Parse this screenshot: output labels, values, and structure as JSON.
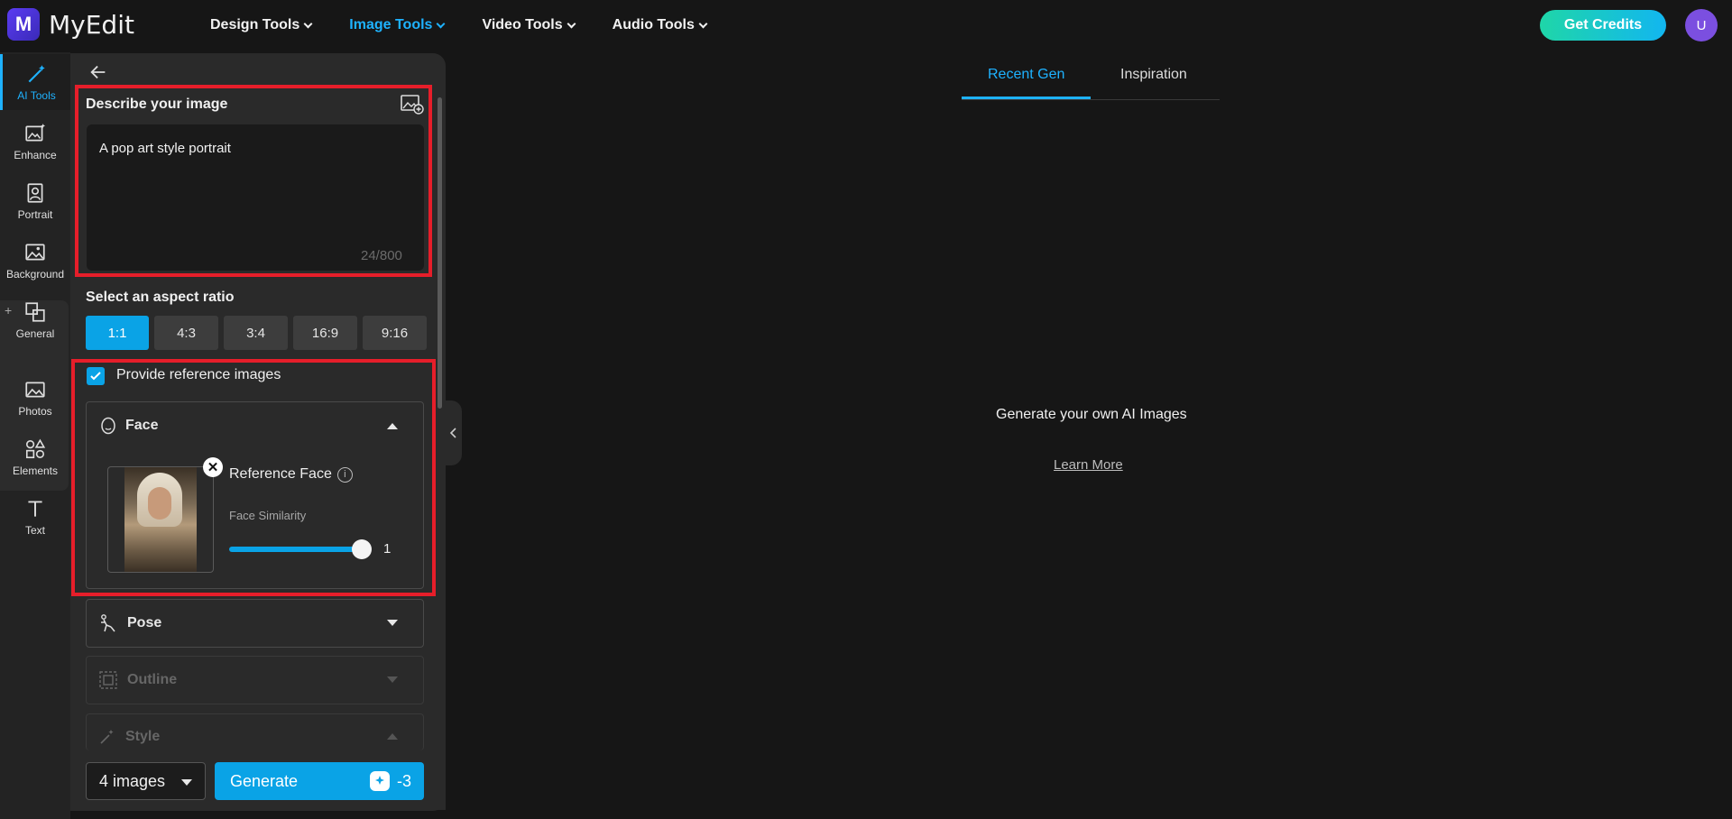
{
  "app": {
    "name": "MyEdit",
    "logo_letter": "M"
  },
  "nav": {
    "items": [
      {
        "label": "Design Tools",
        "active": false
      },
      {
        "label": "Image Tools",
        "active": true
      },
      {
        "label": "Video Tools",
        "active": false
      },
      {
        "label": "Audio Tools",
        "active": false
      }
    ],
    "credits_label": "Get Credits",
    "avatar_initial": "U"
  },
  "rail": {
    "items": [
      {
        "label": "AI Tools",
        "icon": "magic-wand-icon",
        "active": true
      },
      {
        "label": "Enhance",
        "icon": "enhance-image-icon"
      },
      {
        "label": "Portrait",
        "icon": "portrait-icon"
      },
      {
        "label": "Background",
        "icon": "background-icon"
      },
      {
        "label": "General",
        "icon": "layers-icon"
      },
      {
        "label": "Photos",
        "icon": "photo-icon"
      },
      {
        "label": "Elements",
        "icon": "shapes-icon"
      },
      {
        "label": "Text",
        "icon": "text-icon"
      }
    ],
    "plus": "+"
  },
  "panel": {
    "describe_title": "Describe your image",
    "prompt_value": "A pop art style portrait",
    "char_count": "24/800",
    "ratio_title": "Select an aspect ratio",
    "ratios": [
      "1:1",
      "4:3",
      "3:4",
      "16:9",
      "9:16"
    ],
    "ratio_selected": "1:1",
    "reference_label": "Provide reference images",
    "reference_checked": true,
    "face": {
      "title": "Face",
      "reference_label": "Reference Face",
      "info": "i",
      "similarity_label": "Face Similarity",
      "similarity_value": "1",
      "remove": "✕"
    },
    "pose_title": "Pose",
    "outline_title": "Outline",
    "style_title": "Style",
    "count_value": "4 images",
    "generate_label": "Generate",
    "generate_cost": "-3"
  },
  "main": {
    "tabs": [
      {
        "label": "Recent Gen",
        "active": true
      },
      {
        "label": "Inspiration",
        "active": false
      }
    ],
    "empty_title": "Generate your own AI Images",
    "learn_more": "Learn More"
  },
  "colors": {
    "accent": "#0aa3e6",
    "highlight_border": "#e61e2a"
  }
}
